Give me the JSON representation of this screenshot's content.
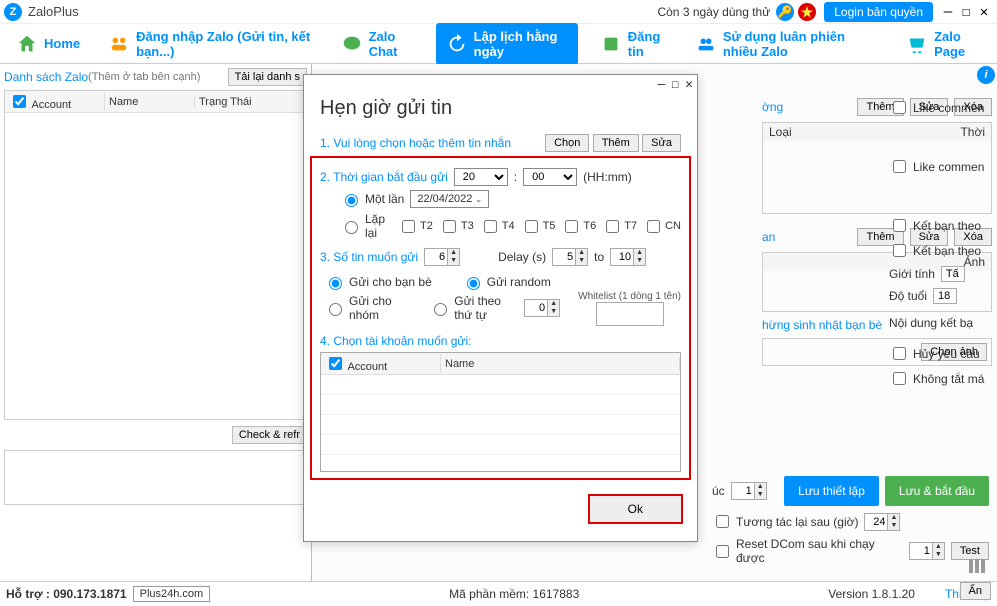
{
  "titlebar": {
    "app_name": "ZaloPlus",
    "trial_text": "Còn 3 ngày dùng thử",
    "login_btn": "Login bản quyền"
  },
  "tabs": {
    "home": "Home",
    "login": "Đăng nhập Zalo (Gửi tin, kết bạn...)",
    "chat": "Zalo Chat",
    "schedule": "Lập lịch hằng ngày",
    "post": "Đăng tin",
    "multi": "Sử dụng luân phiên nhiều Zalo",
    "page": "Zalo Page"
  },
  "left": {
    "title": "Danh sách Zalo",
    "sub": "(Thêm ở tab bên cạnh)",
    "reload": "Tải lại danh s",
    "cols": {
      "account": "Account",
      "name": "Name",
      "status": "Trạng Thái"
    },
    "check_btn": "Check & refr"
  },
  "right": {
    "them": "Thêm",
    "sua": "Sửa",
    "xoa": "Xóa",
    "loai": "Loại",
    "thoi": "Thời",
    "like_commen": "Like commen",
    "ketban_theo": "Kết bạn theo",
    "gioitinh": "Giới tính",
    "gioitinh_val": "Tấ",
    "dotuoi": "Độ tuổi",
    "dotuoi_val": "18",
    "anh": "Ảnh",
    "noidung": "Nội dung kết bạ",
    "huy_yc": "Hủy yêu cầu",
    "khong_tat": "Không tắt má",
    "sinhnhat": "hừng sinh nhật bạn bè",
    "chon_anh": "Chọn ảnh",
    "uc": "úc",
    "uc_val": "1",
    "luu_thiet_lap": "Lưu thiết lập",
    "luu_bat_dau": "Lưu & bắt đầu",
    "tuongtac": "Tương tác lại sau (giờ)",
    "tuongtac_val": "24",
    "reset_dcom": "Reset DCom sau khi chạy được",
    "reset_val": "1",
    "test": "Test",
    "an": "Ẩn"
  },
  "footer": {
    "hotro": "Hỗ trợ : 090.173.1871",
    "plus24h": "Plus24h.com",
    "ma_pm": "Mã phần mềm: 1617883",
    "version": "Version 1.8.1.20",
    "thietlap": "Thiết lập"
  },
  "modal": {
    "title": "Hẹn giờ gửi tin",
    "s1": "1. Vui lòng chọn hoặc thêm tin nhắn",
    "chon": "Chọn",
    "them": "Thêm",
    "sua": "Sửa",
    "s2": "2. Thời gian bắt đầu gửi",
    "hour": "20",
    "minute": "00",
    "hhmm": "(HH:mm)",
    "motlan": "Một lần",
    "motlan_date": "22/04/2022",
    "laplai": "Lặp lại",
    "t2": "T2",
    "t3": "T3",
    "t4": "T4",
    "t5": "T5",
    "t6": "T6",
    "t7": "T7",
    "cn": "CN",
    "s3": "3. Số tin muốn gửi",
    "s3_val": "6",
    "delay": "Delay (s)",
    "delay_from": "5",
    "to": "to",
    "delay_to": "10",
    "gui_banbe": "Gửi cho bạn bè",
    "gui_nhom": "Gửi cho nhóm",
    "gui_random": "Gửi random",
    "gui_thutu": "Gửi theo thứ tự",
    "thutu_val": "0",
    "whitelist": "Whitelist (1 dòng 1 tên)",
    "s4": "4. Chọn tài khoản muốn gửi:",
    "col_account": "Account",
    "col_name": "Name",
    "ok": "Ok"
  }
}
